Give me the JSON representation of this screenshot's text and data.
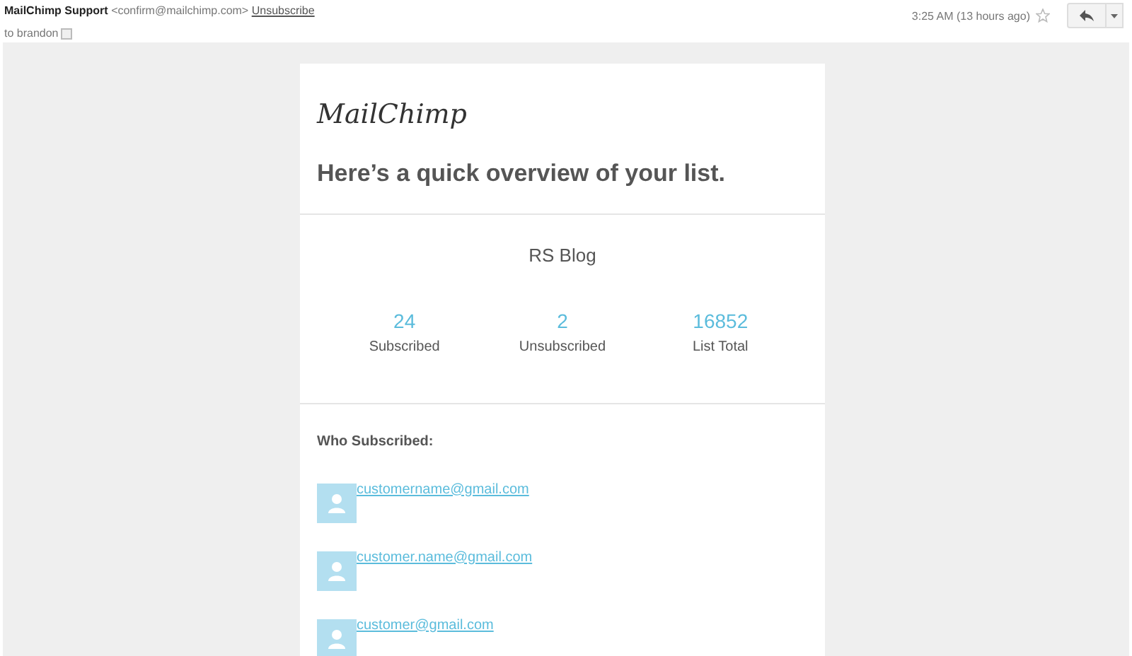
{
  "header": {
    "sender": "MailChimp Support",
    "sender_email": "<confirm@mailchimp.com>",
    "unsubscribe": "Unsubscribe",
    "recipient": "to brandon",
    "time": "3:25 AM (13 hours ago)",
    "starred": false
  },
  "email": {
    "logo": "MailChimp",
    "heading": "Here’s a quick overview of your list.",
    "list_name": "RS Blog",
    "stats": [
      {
        "value": "24",
        "label": "Subscribed"
      },
      {
        "value": "2",
        "label": "Unsubscribed"
      },
      {
        "value": "16852",
        "label": "List Total"
      }
    ],
    "subscribers_title": "Who Subscribed:",
    "subscribers": [
      {
        "email": "customername@gmail.com"
      },
      {
        "email": "customer.name@gmail.com"
      },
      {
        "email": "customer@gmail.com"
      }
    ]
  }
}
